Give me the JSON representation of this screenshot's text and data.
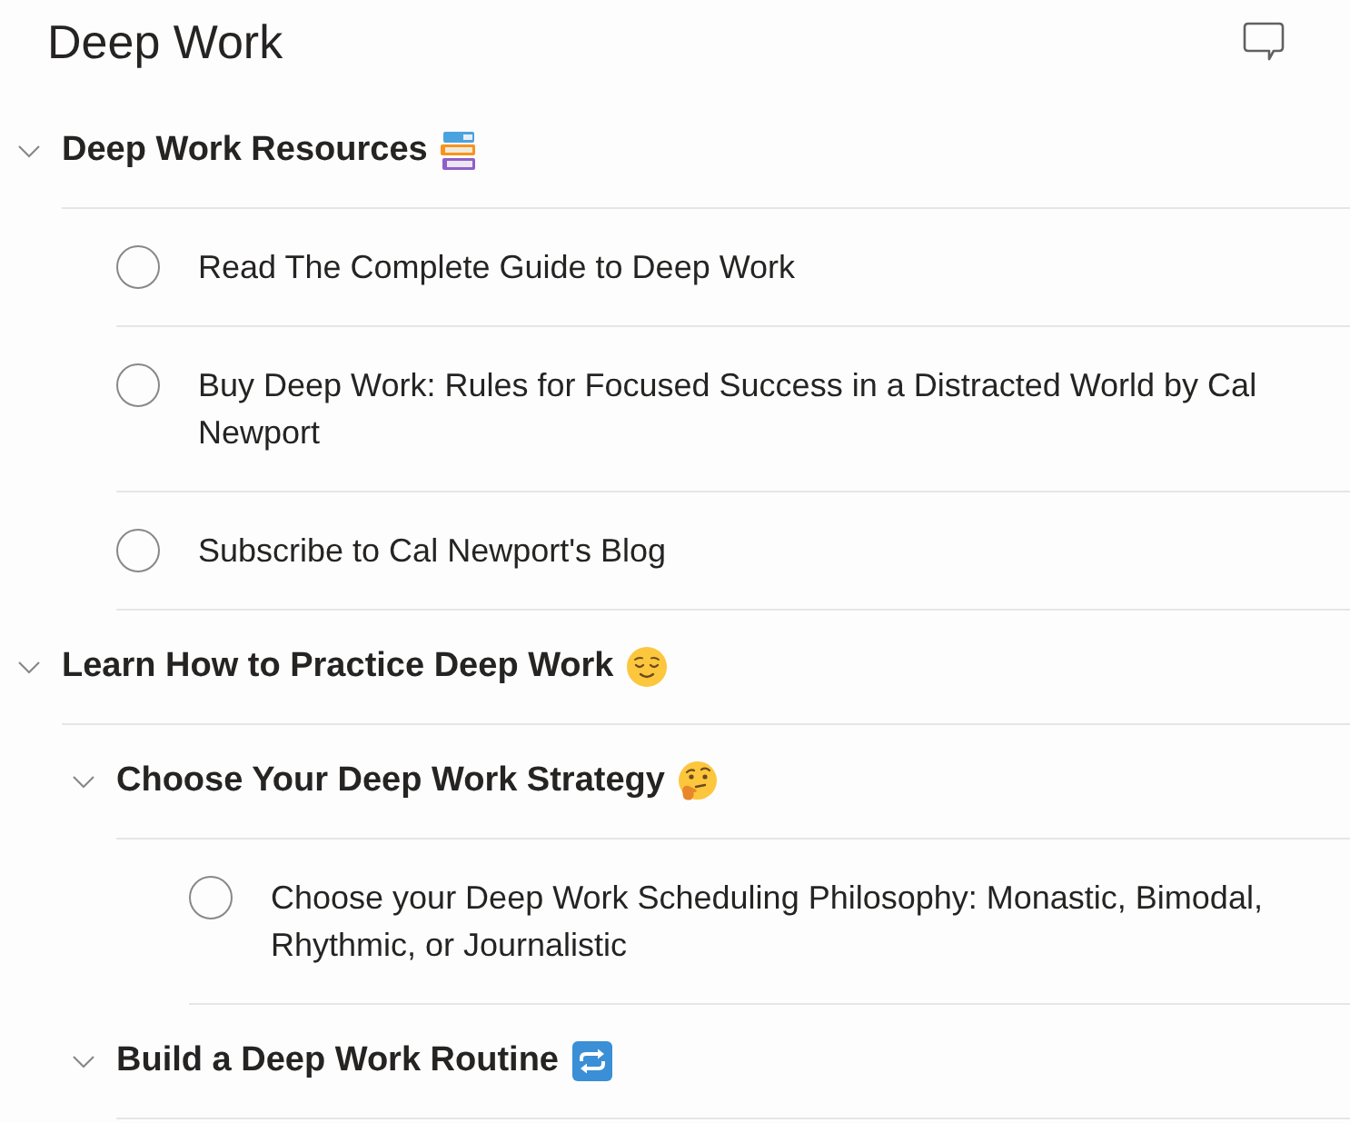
{
  "title": "Deep Work",
  "items": [
    {
      "kind": "heading",
      "title": "Deep Work Resources",
      "expanded": true,
      "children": [
        {
          "kind": "task",
          "title": "Read The Complete Guide to Deep Work",
          "completed": false
        },
        {
          "kind": "task",
          "title": "Buy Deep Work: Rules for Focused Success in a Distracted World by Cal Newport",
          "completed": false
        },
        {
          "kind": "task",
          "title": "Subscribe to Cal Newport's Blog",
          "completed": false
        }
      ]
    },
    {
      "kind": "heading",
      "title": "Learn How to Practice Deep Work",
      "expanded": true,
      "children": [
        {
          "kind": "heading",
          "title": "Choose Your Deep Work Strategy",
          "expanded": true,
          "children": [
            {
              "kind": "task",
              "title": "Choose your Deep Work Scheduling Philosophy: Monastic, Bimodal, Rhythmic, or Journalistic",
              "completed": false
            }
          ]
        },
        {
          "kind": "heading",
          "title": "Build a Deep Work Routine",
          "expanded": true
        }
      ]
    }
  ]
}
